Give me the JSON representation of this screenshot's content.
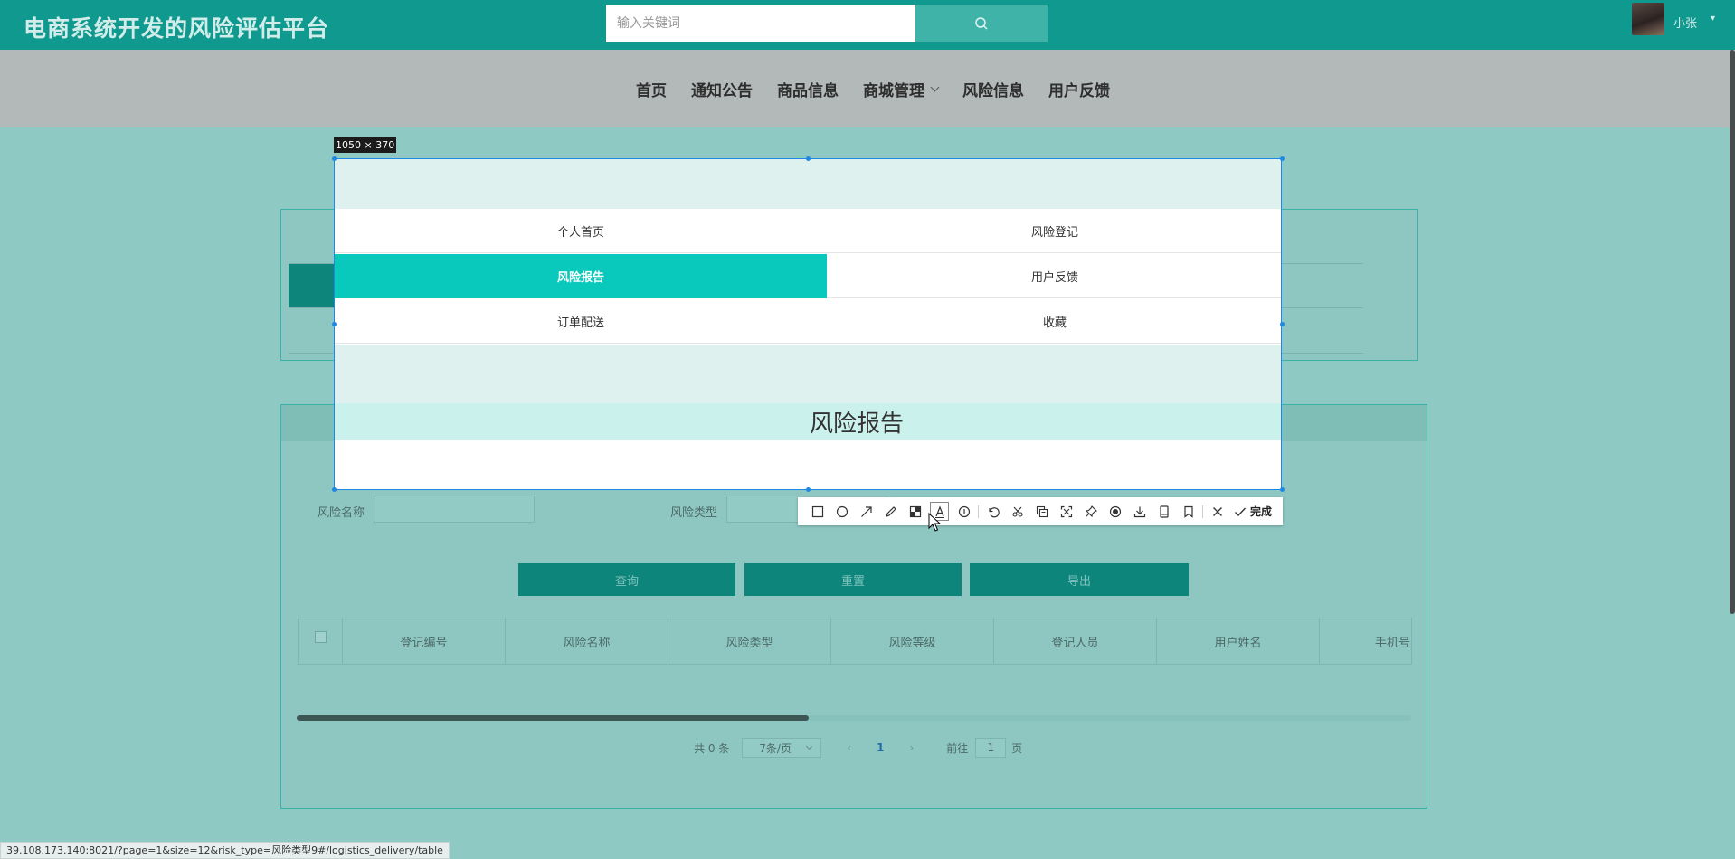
{
  "header": {
    "title": "电商系统开发的风险评估平台",
    "search_placeholder": "输入关键词",
    "search_icon": "search-icon",
    "user_name": "小张",
    "user_caret": "▾"
  },
  "nav": {
    "items": [
      "首页",
      "通知公告",
      "商品信息",
      "商城管理",
      "风险信息",
      "用户反馈"
    ]
  },
  "capture": {
    "size_label": "1050 × 370",
    "menu": {
      "home": "个人首页",
      "risk_register": "风险登记",
      "risk_report": "风险报告",
      "feedback": "用户反馈",
      "delivery": "订单配送",
      "favorites": "收藏"
    },
    "section_title": "风险报告",
    "toolbar": {
      "icons": [
        "rectangle-icon",
        "ellipse-icon",
        "arrow-icon",
        "pencil-icon",
        "mosaic-icon",
        "text-icon",
        "number-icon",
        "undo-icon",
        "crop-icon",
        "ocr-icon",
        "screen-icon",
        "pin-icon",
        "record-icon",
        "download-icon",
        "device-icon",
        "bookmark-icon",
        "close-icon",
        "check-icon"
      ],
      "done_label": "完成"
    }
  },
  "filters": {
    "risk_name_label": "风险名称",
    "risk_type_label": "风险类型"
  },
  "buttons": {
    "query": "查询",
    "reset": "重置",
    "export": "导出"
  },
  "table": {
    "columns": [
      "登记编号",
      "风险名称",
      "风险类型",
      "风险等级",
      "登记人员",
      "用户姓名",
      "手机号"
    ]
  },
  "pager": {
    "total": "共 0 条",
    "page_size": "7条/页",
    "prev": "‹",
    "current": "1",
    "next": "›",
    "goto": "前往",
    "goto_value": "1",
    "unit": "页"
  },
  "status_url": "39.108.173.140:8021/?page=1&size=12&risk_type=风险类型9#/logistics_delivery/table",
  "colors": {
    "brand": "#109a8f",
    "active_menu": "#08c9bb",
    "selection": "#1e88e5"
  }
}
